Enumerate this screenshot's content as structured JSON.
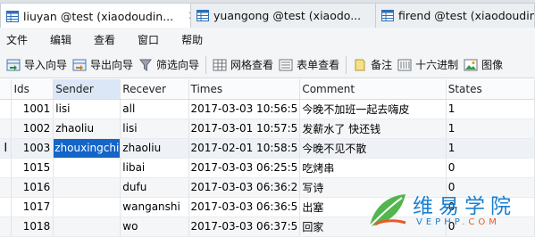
{
  "tabs": [
    {
      "label": "liuyan @test (xiaodoudin...",
      "close": "✕",
      "active": true
    },
    {
      "label": "yuangong @test (xiaodo...",
      "close": "",
      "active": false
    },
    {
      "label": "firend @test (xiaodoudin...",
      "close": "",
      "active": false
    }
  ],
  "menu": [
    "文件",
    "编辑",
    "查看",
    "窗口",
    "帮助"
  ],
  "toolbar": {
    "import": "导入向导",
    "export": "导出向导",
    "filter": "筛选向导",
    "grid_view": "网格查看",
    "form_view": "表单查看",
    "memo": "备注",
    "hex": "十六进制",
    "image": "图像"
  },
  "grid": {
    "columns": [
      "Ids",
      "Sender",
      "Recever",
      "Times",
      "Comment",
      "States"
    ],
    "rows": [
      {
        "ids": "1001",
        "sender": "lisi",
        "recever": "all",
        "times": "2017-03-03 10:56:5",
        "comment": "今晚不加班一起去嗨皮",
        "states": "1"
      },
      {
        "ids": "1002",
        "sender": "zhaoliu",
        "recever": "lisi",
        "times": "2017-03-01 10:57:5",
        "comment": "发薪水了 快还钱",
        "states": "1"
      },
      {
        "ids": "1003",
        "sender": "zhouxingchi",
        "recever": "zhaoliu",
        "times": "2017-02-01 10:58:5",
        "comment": "今晚不见不散",
        "states": "1"
      },
      {
        "ids": "1015",
        "sender": "",
        "recever": "libai",
        "times": "2017-03-03 06:25:5",
        "comment": "吃烤串",
        "states": "0"
      },
      {
        "ids": "1016",
        "sender": "",
        "recever": "dufu",
        "times": "2017-03-03 06:36:2",
        "comment": "写诗",
        "states": "0"
      },
      {
        "ids": "1017",
        "sender": "",
        "recever": "wanganshi",
        "times": "2017-03-03 06:36:5",
        "comment": "出塞",
        "states": "0"
      },
      {
        "ids": "1018",
        "sender": "",
        "recever": "wo",
        "times": "2017-03-03 06:37:5",
        "comment": "回家",
        "states": "0"
      }
    ],
    "cursor_marker": "I"
  },
  "watermark": {
    "title": "维易学院",
    "site": "VEPHP",
    "tld": ".COM"
  },
  "colors": {
    "selection": "#1565c8",
    "watermark_blue": "#1a7fd0",
    "watermark_orange": "#e85a2a"
  }
}
